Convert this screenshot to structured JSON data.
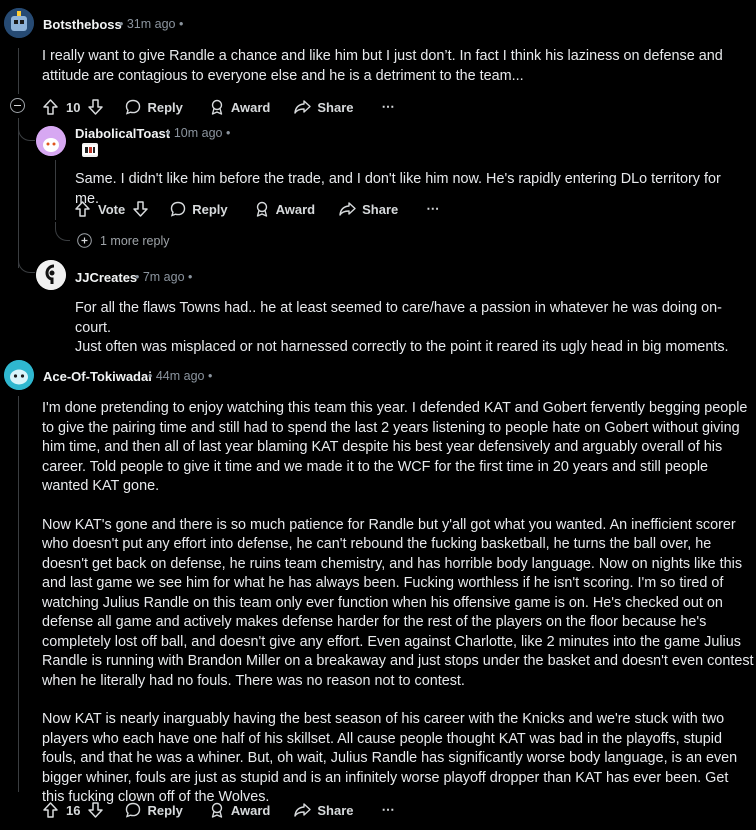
{
  "comments": [
    {
      "author": "Botstheboss",
      "meta": "• 31m ago •",
      "text": "I really want to give Randle a chance and like him but I just don’t. In fact I think his laziness on defense and attitude are contagious to everyone else and he is a detriment to the team...",
      "score": "10",
      "reply": "Reply",
      "award": "Award",
      "share": "Share",
      "more": "⋯"
    },
    {
      "author": "DiabolicalToast",
      "meta": "• 10m ago •",
      "text": "Same. I didn't like him before the trade, and I don't like him now. He's rapidly entering DLo territory for me.",
      "vote": "Vote",
      "reply": "Reply",
      "award": "Award",
      "share": "Share",
      "more": "⋯",
      "more_replies": "1 more reply"
    },
    {
      "author": "JJCreates",
      "meta": "• 7m ago •",
      "text_lines": [
        "For all the flaws Towns had.. he at least seemed to care/have a passion in whatever he was doing on-court.",
        "Just often was misplaced or not harnessed correctly to the point it reared its ugly head in big moments."
      ]
    },
    {
      "author": "Ace-Of-Tokiwadai",
      "meta": "• 44m ago •",
      "paragraphs": [
        "I'm done pretending to enjoy watching this team this year. I defended KAT and Gobert fervently begging people to give the pairing time and still had to spend the last 2 years listening to people hate on Gobert without giving him time, and then all of last year blaming KAT despite his best year defensively and arguably overall of his career. Told people to give it time and we made it to the WCF for the first time in 20 years and still people wanted KAT gone.",
        "Now KAT's gone and there is so much patience for Randle but y'all got what you wanted. An inefficient scorer who doesn't put any effort into defense, he can't rebound the fucking basketball, he turns the ball over, he doesn't get back on defense, he ruins team chemistry, and has horrible body language. Now on nights like this and last game we see him for what he has always been. Fucking worthless if he isn't scoring. I'm so tired of watching Julius Randle on this team only ever function when his offensive game is on. He's checked out on defense all game and actively makes defense harder for the rest of the players on the floor because he's completely lost off ball, and doesn't give any effort. Even against Charlotte, like 2 minutes into the game Julius Randle is running with Brandon Miller on a breakaway and just stops under the basket and doesn't even contest when he literally had no fouls. There was no reason not to contest.",
        "Now KAT is nearly inarguably having the best season of his career with the Knicks and we're stuck with two players who each have one half of his skillset. All cause people thought KAT was bad in the playoffs, stupid fouls, and that he was a whiner. But, oh wait, Julius Randle has significantly worse body language, is an even bigger whiner, fouls are just as stupid and is an infinitely worse playoff dropper than KAT has ever been. Get this fucking clown off of the Wolves."
      ],
      "score": "16",
      "reply": "Reply",
      "award": "Award",
      "share": "Share",
      "more": "⋯"
    }
  ],
  "colors": {
    "background": "#000000",
    "text": "#e8eaed",
    "meta": "#8b949e",
    "line": "#3a3d40"
  }
}
